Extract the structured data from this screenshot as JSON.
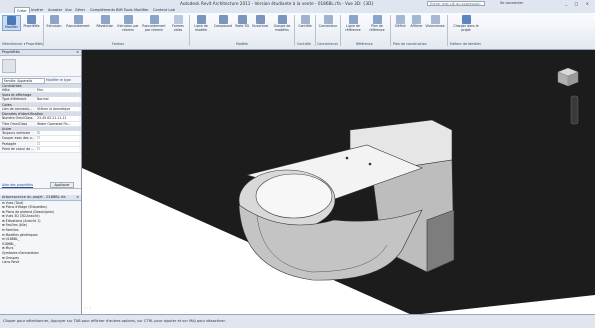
{
  "window": {
    "title": "Autodesk Revit Architecture 2011 - Version étudiante à la vente - 0186BL.rfa - Vue 3D: {3D}",
    "search_placeholder": "Entrer mot clé ou expression",
    "signin": "Se connecter",
    "window_buttons": "_ □ ×"
  },
  "ribbon_tabs": [
    "Créer",
    "Insérer",
    "Annoter",
    "Vue",
    "Gérer",
    "Compléments",
    "BIM Tools",
    "Modifier",
    "Content Lab"
  ],
  "ribbon": {
    "buttons": [
      {
        "label": "Modifier",
        "icon": "pointer-icon"
      },
      {
        "label": "Propriétés",
        "icon": "properties-icon"
      },
      {
        "label": "Extrusion",
        "icon": "extrusion-icon"
      },
      {
        "label": "Raccordement",
        "icon": "blend-icon"
      },
      {
        "label": "Révolution",
        "icon": "revolve-icon"
      },
      {
        "label": "Extrusion par chemin",
        "icon": "sweep-icon"
      },
      {
        "label": "Raccordement par chemin",
        "icon": "swept-blend-icon"
      },
      {
        "label": "Formes vides",
        "icon": "void-forms-icon"
      },
      {
        "label": "Ligne de modèle",
        "icon": "model-line-icon"
      },
      {
        "label": "Composant",
        "icon": "component-icon"
      },
      {
        "label": "Texte 3D",
        "icon": "model-text-icon"
      },
      {
        "label": "Ouverture",
        "icon": "opening-icon"
      },
      {
        "label": "Groupe de modèles",
        "icon": "model-group-icon"
      },
      {
        "label": "Contrôle",
        "icon": "control-icon"
      },
      {
        "label": "Connecteur",
        "icon": "connector-icon"
      },
      {
        "label": "Ligne de référence",
        "icon": "reference-line-icon"
      },
      {
        "label": "Plan de référence",
        "icon": "reference-plane-icon"
      },
      {
        "label": "Définir",
        "icon": "set-workplane-icon"
      },
      {
        "label": "Afficher",
        "icon": "show-workplane-icon"
      },
      {
        "label": "Visionneuse",
        "icon": "viewer-icon"
      },
      {
        "label": "Charger dans le projet",
        "icon": "load-into-project-icon"
      }
    ],
    "groups": [
      "Sélectionner ▾",
      "Propriétés",
      "Formes",
      "Modèle",
      "Contrôle",
      "Connecteurs",
      "Référence",
      "Plan de construction",
      "Editeur de familles"
    ]
  },
  "properties": {
    "title": "Propriétés",
    "type_selector": "Famille: Appareils",
    "edit_type": "Modifier le type",
    "sections": [
      {
        "name": "Contraintes",
        "rows": [
          {
            "k": "Hôte",
            "v": "Mur"
          }
        ]
      },
      {
        "name": "Vues et affichage",
        "rows": [
          {
            "k": "Type d'élément",
            "v": "Normal"
          }
        ]
      },
      {
        "name": "Cotes",
        "rows": [
          {
            "k": "Lien de connexio...",
            "v": "Utiliser la domotique"
          }
        ]
      },
      {
        "name": "Données d'identification",
        "rows": [
          {
            "k": "Numéro OmniClass",
            "v": "23.45.05.21.11.11"
          },
          {
            "k": "Titre OmniClass",
            "v": "Water Operated Fix..."
          }
        ]
      },
      {
        "name": "Autre",
        "rows": [
          {
            "k": "Toujours verticale",
            "v": "☑"
          },
          {
            "k": "Couper avec des v...",
            "v": "☐"
          },
          {
            "k": "Partagée",
            "v": "☐"
          },
          {
            "k": "Point de calcul de ...",
            "v": "☐"
          }
        ]
      }
    ],
    "help_link": "Aide des propriétés",
    "apply": "Appliquer"
  },
  "browser": {
    "title": "Arborescence du projet - 0186BL.rfa",
    "items": [
      "⊟ Vues (Tout)",
      "  ⊞ Plans d'étage (Etiquettes)",
      "  ⊞ Plans de plafond (Dessin/plan)",
      "  ⊞ Vues 3D (3D-Ansicht)",
      "  ⊞ Élévations (Ansicht 1)",
      "  ⊞ Feuilles (Alle)",
      "⊟ Familles",
      "  ⊟ Modèles génériques",
      "      ⊟ 0186BL_",
      "          0186BL_",
      "  ⊞ Murs",
      "    Symboles d'annotation",
      "⊞ Groupes",
      "  Liens Revit"
    ]
  },
  "view": {
    "scale": "1 : 5"
  },
  "status": {
    "text": "Cliquer pour sélectionner, Appuyer sur TAB pour afficher d'autres options, sur CTRL pour ajouter et sur MAJ pour désactiver."
  },
  "viewcube": {
    "label": "viewcube"
  }
}
